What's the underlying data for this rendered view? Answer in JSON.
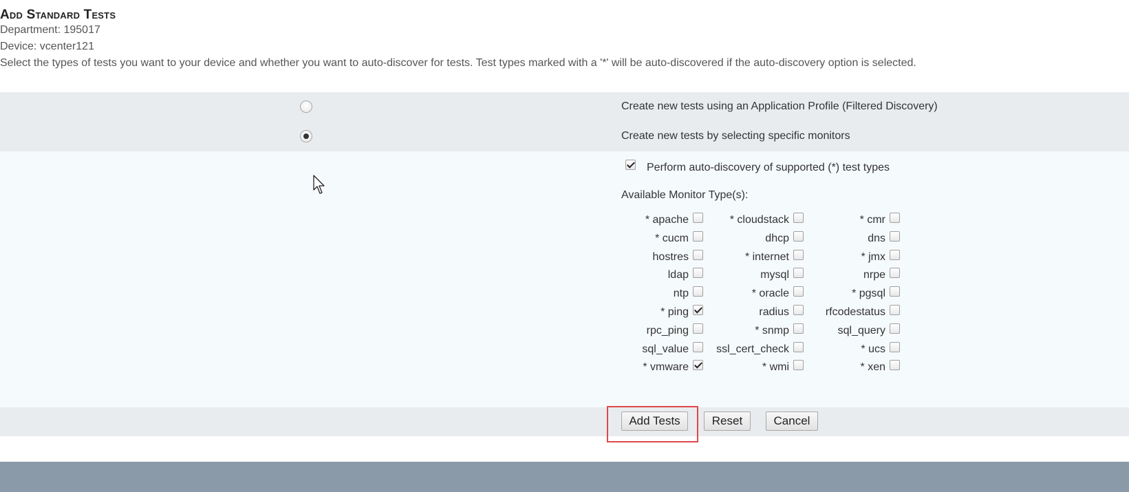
{
  "header": {
    "title": "Add Standard Tests",
    "department": "Department: 195017",
    "device": "Device: vcenter121",
    "description": "Select the types of tests you want to your device and whether you want to auto-discover for tests. Test types marked with a '*' will be auto-discovered if the auto-discovery option is selected."
  },
  "options": {
    "profile_label": "Create new tests using an Application Profile (Filtered Discovery)",
    "profile_selected": false,
    "specific_label": "Create new tests by selecting specific monitors",
    "specific_selected": true
  },
  "autodiscovery": {
    "label": "Perform auto-discovery of supported (*) test types",
    "checked": true
  },
  "monitors": {
    "heading": "Available Monitor Type(s):",
    "rows": [
      [
        {
          "label": "*  apache",
          "checked": false
        },
        {
          "label": "*  cloudstack",
          "checked": false
        },
        {
          "label": "*  cmr",
          "checked": false
        }
      ],
      [
        {
          "label": "*  cucm",
          "checked": false
        },
        {
          "label": "dhcp",
          "checked": false
        },
        {
          "label": "dns",
          "checked": false
        }
      ],
      [
        {
          "label": "hostres",
          "checked": false
        },
        {
          "label": "*  internet",
          "checked": false
        },
        {
          "label": "*  jmx",
          "checked": false
        }
      ],
      [
        {
          "label": "ldap",
          "checked": false
        },
        {
          "label": "mysql",
          "checked": false
        },
        {
          "label": "nrpe",
          "checked": false
        }
      ],
      [
        {
          "label": "ntp",
          "checked": false
        },
        {
          "label": "*  oracle",
          "checked": false
        },
        {
          "label": "*  pgsql",
          "checked": false
        }
      ],
      [
        {
          "label": "*  ping",
          "checked": true
        },
        {
          "label": "radius",
          "checked": false
        },
        {
          "label": "rfcodestatus",
          "checked": false
        }
      ],
      [
        {
          "label": "rpc_ping",
          "checked": false
        },
        {
          "label": "*  snmp",
          "checked": false
        },
        {
          "label": "sql_query",
          "checked": false
        }
      ],
      [
        {
          "label": "sql_value",
          "checked": false
        },
        {
          "label": "ssl_cert_check",
          "checked": false
        },
        {
          "label": "*  ucs",
          "checked": false
        }
      ],
      [
        {
          "label": "*  vmware",
          "checked": true
        },
        {
          "label": "*  wmi",
          "checked": false
        },
        {
          "label": "*  xen",
          "checked": false
        }
      ]
    ]
  },
  "buttons": {
    "add_tests": "Add Tests",
    "reset": "Reset",
    "cancel": "Cancel"
  },
  "colors": {
    "highlight": "#e0474c"
  }
}
